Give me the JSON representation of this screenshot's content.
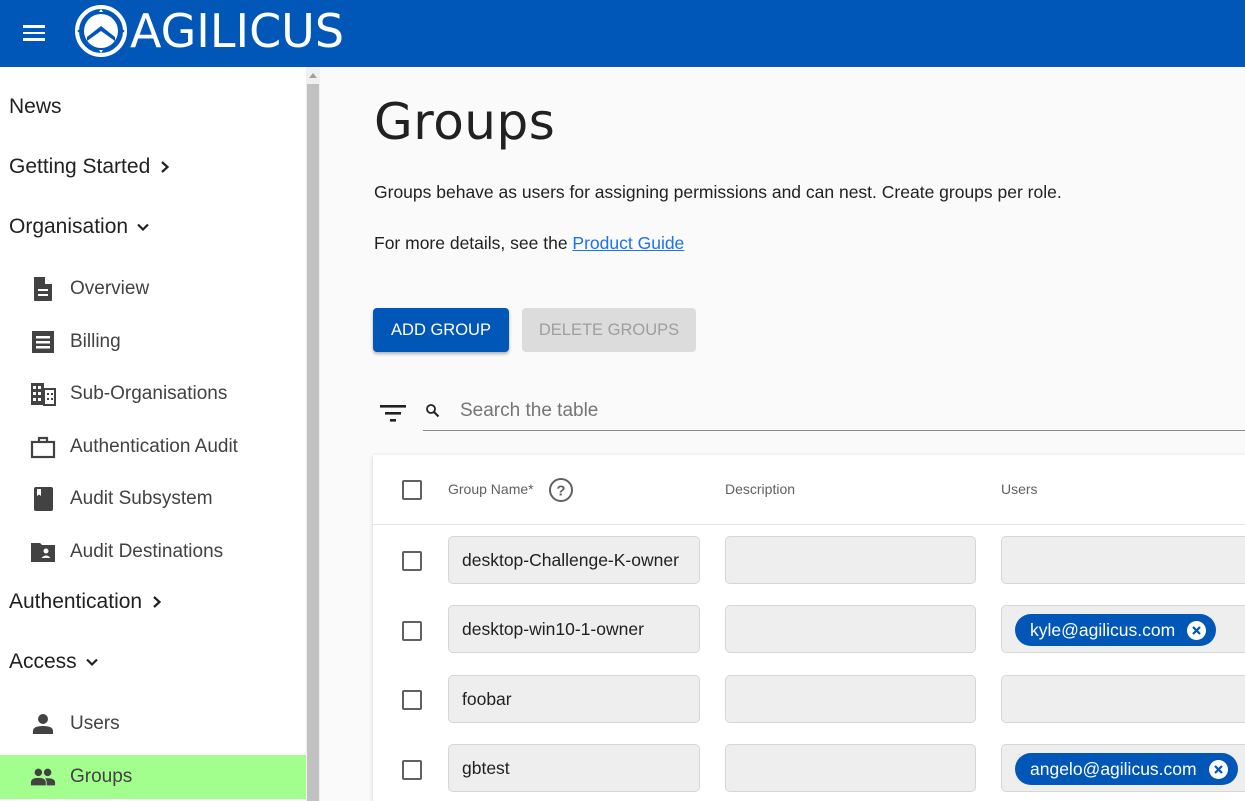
{
  "header": {
    "brand": "AGILICUS",
    "menu_icon": "hamburger-menu-icon",
    "logo_icon": "agilicus-shield-logo"
  },
  "sidebar": {
    "sections": [
      {
        "label": "News",
        "chevron": null
      },
      {
        "label": "Getting Started",
        "chevron": "chevron-right-icon"
      },
      {
        "label": "Organisation",
        "chevron": "chevron-down-icon"
      },
      {
        "label": "Authentication",
        "chevron": "chevron-right-icon"
      },
      {
        "label": "Access",
        "chevron": "chevron-down-icon"
      }
    ],
    "organisation_items": [
      {
        "label": "Overview",
        "icon": "document-icon"
      },
      {
        "label": "Billing",
        "icon": "receipt-icon"
      },
      {
        "label": "Sub-Organisations",
        "icon": "building-icon"
      },
      {
        "label": "Authentication Audit",
        "icon": "briefcase-icon"
      },
      {
        "label": "Audit Subsystem",
        "icon": "book-icon"
      },
      {
        "label": "Audit Destinations",
        "icon": "folder-shared-icon"
      }
    ],
    "access_items": [
      {
        "label": "Users",
        "icon": "person-icon"
      },
      {
        "label": "Groups",
        "icon": "group-icon",
        "active": true
      }
    ],
    "active_color": "#a3ff8d"
  },
  "main": {
    "title": "Groups",
    "description": "Groups behave as users for assigning permissions and can nest. Create groups per role.",
    "more_prefix": "For more details, see the ",
    "more_link": "Product Guide",
    "add_button": "ADD GROUP",
    "delete_button": "DELETE GROUPS",
    "search_placeholder": "Search the table",
    "table": {
      "columns": [
        "Group Name*",
        "Description",
        "Users"
      ],
      "rows": [
        {
          "name": "desktop-Challenge-K-owner",
          "description": "",
          "users": []
        },
        {
          "name": "desktop-win10-1-owner",
          "description": "",
          "users": [
            "kyle@agilicus.com"
          ]
        },
        {
          "name": "foobar",
          "description": "",
          "users": []
        },
        {
          "name": "gbtest",
          "description": "",
          "users": [
            "angelo@agilicus.com"
          ]
        }
      ]
    }
  },
  "colors": {
    "brand_blue": "#0057b8",
    "link": "#1a73e8"
  }
}
